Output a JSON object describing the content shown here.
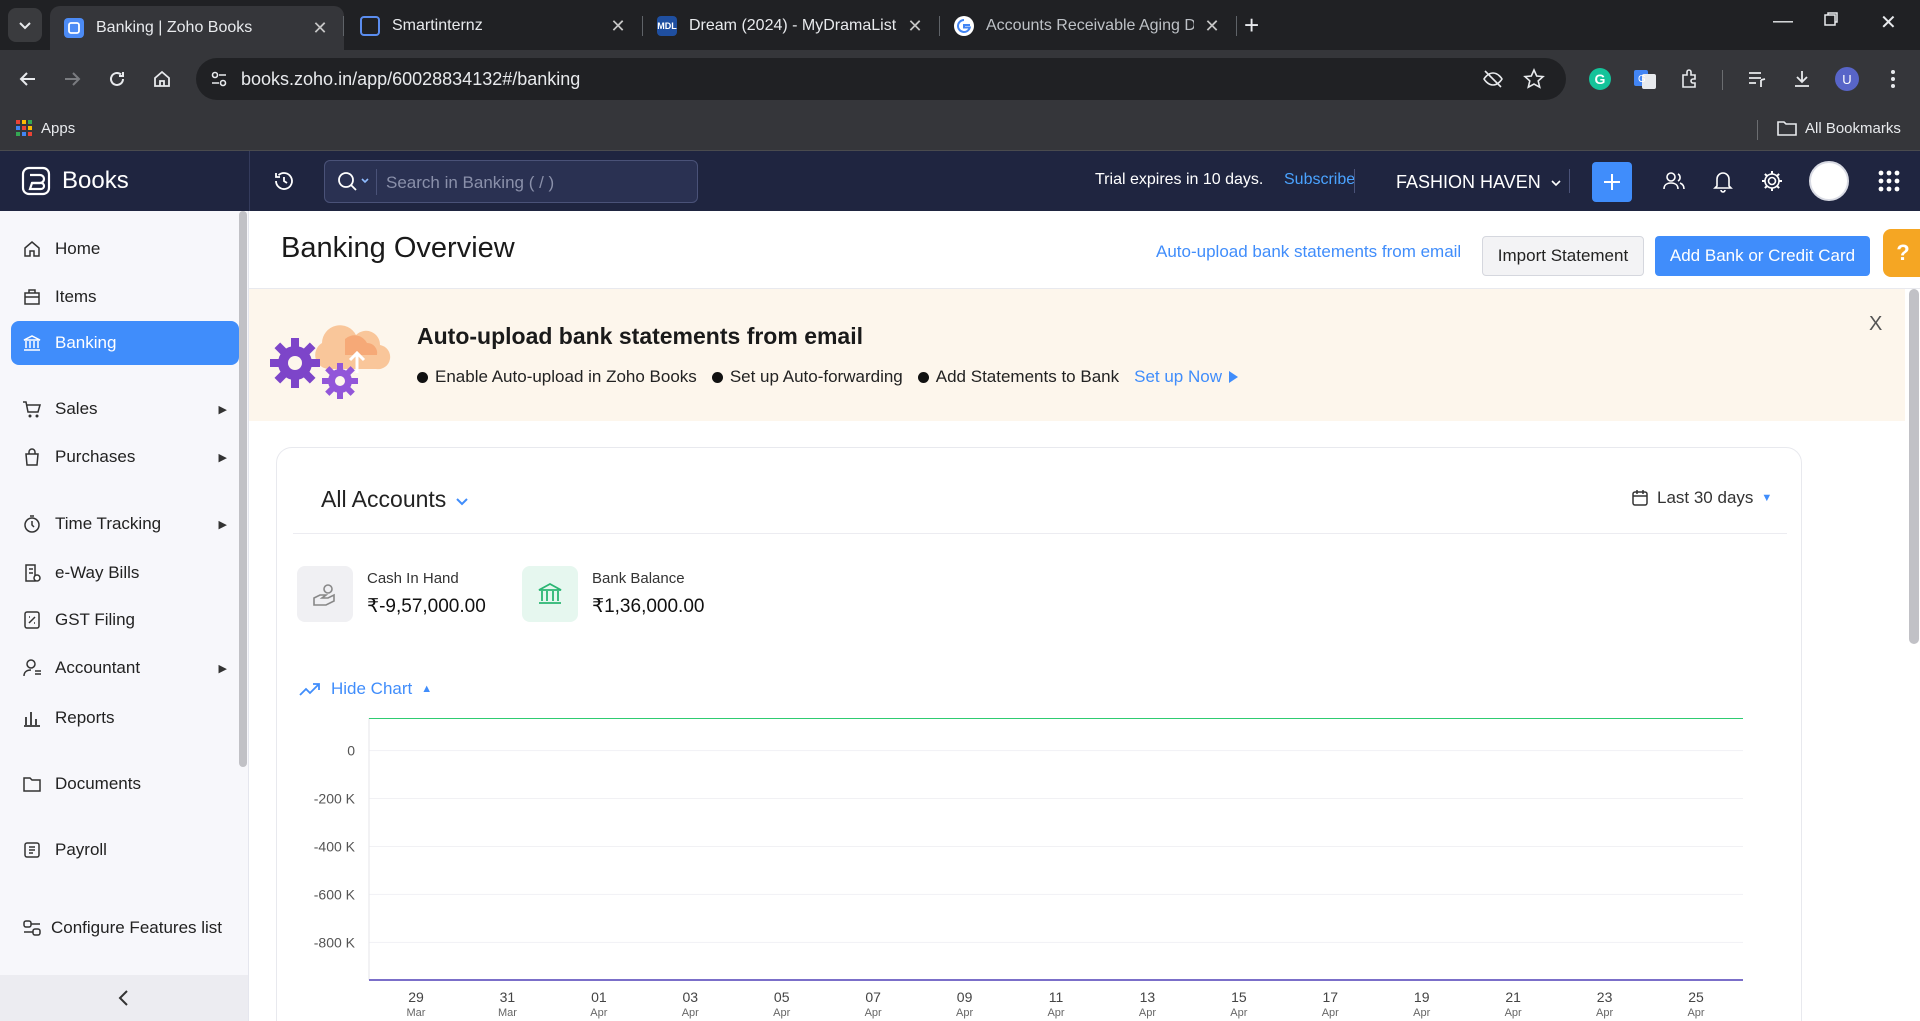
{
  "browser": {
    "tabs": [
      {
        "title": "Banking | Zoho Books",
        "active": true,
        "icon": "zoho-books-favicon"
      },
      {
        "title": "Smartinternz",
        "active": false,
        "icon": "smartinternz-favicon"
      },
      {
        "title": "Dream (2024) - MyDramaList",
        "active": false,
        "icon": "mydramalist-favicon",
        "icon_text": "MDL"
      },
      {
        "title": "Accounts Receivable Aging Det",
        "active": false,
        "icon": "google-favicon"
      }
    ],
    "url": "books.zoho.in/app/60028834132#/banking",
    "profile_initial": "U",
    "bookmarks": {
      "apps": "Apps",
      "all": "All Bookmarks"
    }
  },
  "header": {
    "brand": "Books",
    "search_placeholder": "Search in Banking ( / )",
    "trial": "Trial expires in 10 days.",
    "subscribe": "Subscribe",
    "org": "FASHION HAVEN"
  },
  "sidebar": {
    "items": [
      {
        "label": "Home",
        "icon": "home-icon"
      },
      {
        "label": "Items",
        "icon": "items-icon"
      },
      {
        "label": "Banking",
        "icon": "bank-icon",
        "active": true
      },
      {
        "label": "Sales",
        "icon": "cart-icon",
        "expandable": true
      },
      {
        "label": "Purchases",
        "icon": "bag-icon",
        "expandable": true
      },
      {
        "label": "Time Tracking",
        "icon": "timer-icon",
        "expandable": true
      },
      {
        "label": "e-Way Bills",
        "icon": "eway-bill-icon"
      },
      {
        "label": "GST Filing",
        "icon": "gst-icon"
      },
      {
        "label": "Accountant",
        "icon": "accountant-icon",
        "expandable": true
      },
      {
        "label": "Reports",
        "icon": "reports-icon"
      },
      {
        "label": "Documents",
        "icon": "folder-icon"
      },
      {
        "label": "Payroll",
        "icon": "payroll-icon"
      },
      {
        "label": "Configure Features list",
        "icon": "configure-icon"
      }
    ]
  },
  "main": {
    "title": "Banking Overview",
    "auto_upload_link": "Auto-upload bank statements from email",
    "import_button": "Import Statement",
    "add_button": "Add Bank or Credit Card",
    "help": "?",
    "banner": {
      "title": "Auto-upload bank statements from email",
      "steps": [
        "Enable Auto-upload in Zoho Books",
        "Set up Auto-forwarding",
        "Add Statements to Bank"
      ],
      "cta": "Set up Now",
      "close": "X"
    },
    "accounts": {
      "title": "All Accounts",
      "date_range": "Last 30 days",
      "cash_in_hand": {
        "label": "Cash In Hand",
        "value": "₹-9,57,000.00"
      },
      "bank_balance": {
        "label": "Bank Balance",
        "value": "₹1,36,000.00"
      },
      "hide_chart": "Hide Chart"
    }
  },
  "colors": {
    "accent": "#408dfb",
    "header_bg": "#1f2540",
    "banner_bg": "#fdf6ec",
    "line_green": "#2ecc71",
    "line_purple": "#7b6fc9"
  },
  "chart_data": {
    "type": "line",
    "x_ticks": [
      "29",
      "31",
      "01",
      "03",
      "05",
      "07",
      "09",
      "11",
      "13",
      "15",
      "17",
      "19",
      "21",
      "23",
      "25"
    ],
    "x_tick_sub": [
      "Mar",
      "Mar",
      "Apr",
      "Apr",
      "Apr",
      "Apr",
      "Apr",
      "Apr",
      "Apr",
      "Apr",
      "Apr",
      "Apr",
      "Apr",
      "Apr",
      "Apr"
    ],
    "y_ticks": [
      "0",
      "-200 K",
      "-400 K",
      "-600 K",
      "-800 K"
    ],
    "y_values": [
      0,
      -200000,
      -400000,
      -600000,
      -800000
    ],
    "ylim": [
      -957000,
      136000
    ],
    "grid": true,
    "series": [
      {
        "color": "#2ecc71",
        "values": [
          136000,
          136000,
          136000,
          136000,
          136000,
          136000,
          136000,
          136000,
          136000,
          136000,
          136000,
          136000,
          136000,
          136000,
          136000
        ]
      },
      {
        "color": "#7b6fc9",
        "values": [
          -957000,
          -957000,
          -957000,
          -957000,
          -957000,
          -957000,
          -957000,
          -957000,
          -957000,
          -957000,
          -957000,
          -957000,
          -957000,
          -957000,
          -957000
        ]
      }
    ]
  }
}
